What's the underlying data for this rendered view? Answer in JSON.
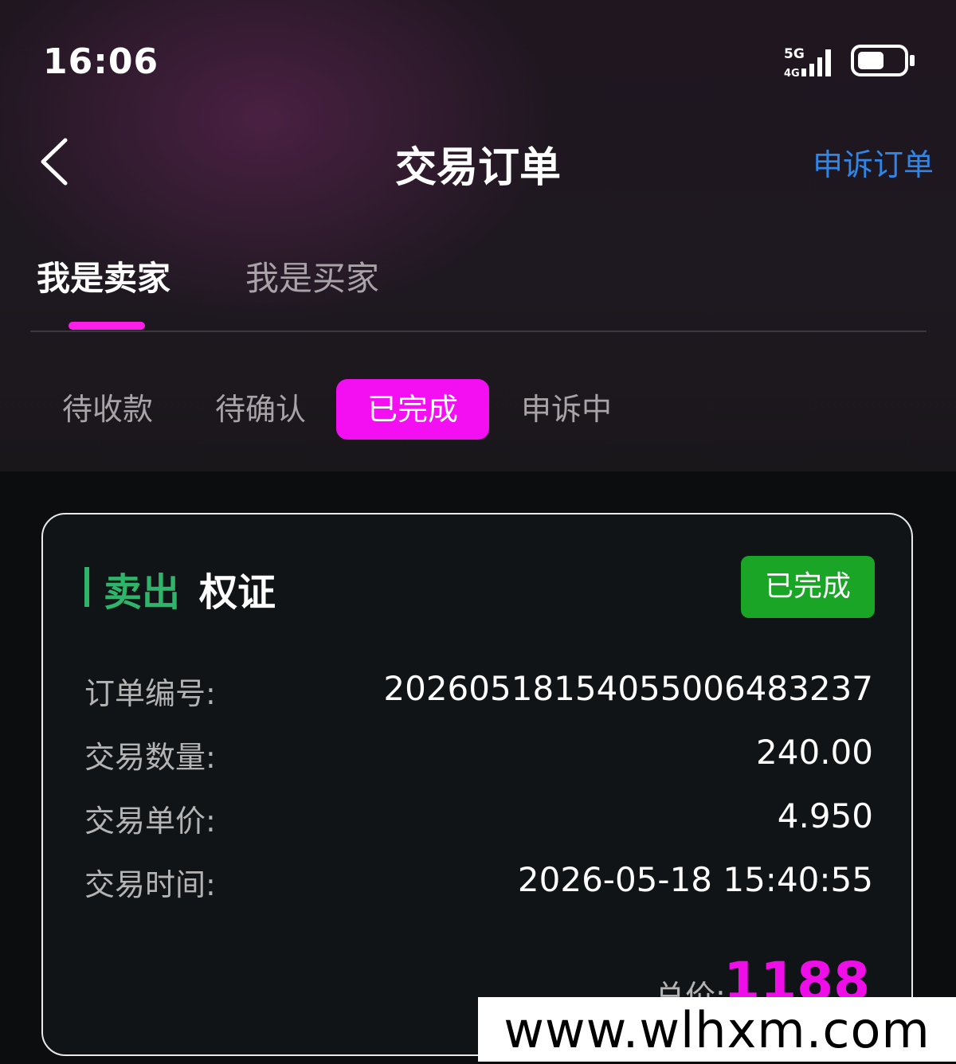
{
  "status_bar": {
    "time": "16:06",
    "network": "5G",
    "network_sub": "4G"
  },
  "header": {
    "title": "交易订单",
    "appeal_link": "申诉订单"
  },
  "role_tabs": [
    {
      "label": "我是卖家"
    },
    {
      "label": "我是买家"
    }
  ],
  "status_tabs": [
    {
      "label": "待收款"
    },
    {
      "label": "待确认"
    },
    {
      "label": "已完成"
    },
    {
      "label": "申诉中"
    }
  ],
  "order": {
    "side": "卖出",
    "asset": "权证",
    "status": "已完成",
    "fields": [
      {
        "label": "订单编号:",
        "value": "20260518154055006483237"
      },
      {
        "label": "交易数量:",
        "value": "240.00"
      },
      {
        "label": "交易单价:",
        "value": "4.950"
      },
      {
        "label": "交易时间:",
        "value": "2026-05-18 15:40:55"
      }
    ],
    "total_label": "总价:",
    "total_value": "1188"
  },
  "watermark": "www.wlhxm.com",
  "colors": {
    "accent": "#f40ef2",
    "sell": "#2fb56a",
    "badge": "#1aa527",
    "link": "#2f86e6"
  }
}
